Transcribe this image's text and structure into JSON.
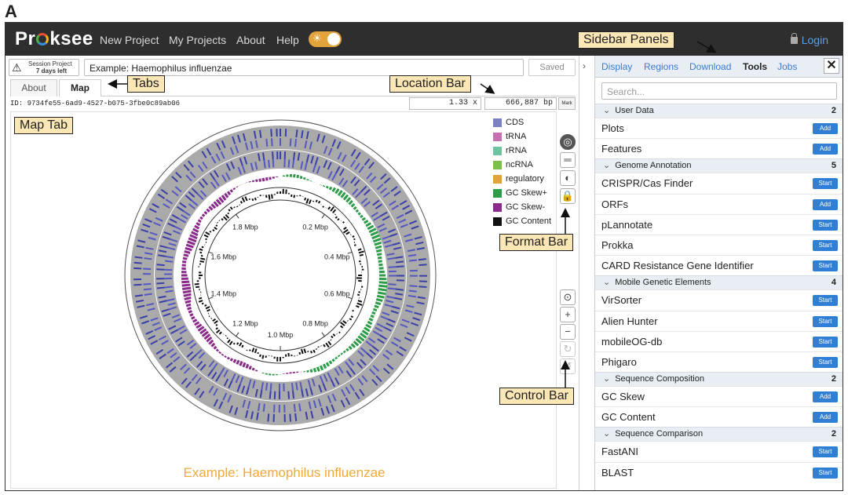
{
  "figure_letter": "A",
  "header": {
    "logo": "Proksee",
    "nav": [
      "New Project",
      "My Projects",
      "About",
      "Help"
    ],
    "login": "Login",
    "theme_toggle": "on"
  },
  "session": {
    "line1": "Session Project",
    "line2": "7 days left"
  },
  "project_title": "Example: Haemophilus influenzae",
  "saved_label": "Saved",
  "tabs": [
    {
      "label": "About"
    },
    {
      "label": "Map"
    }
  ],
  "active_tab": "Map",
  "map_id": "ID: 9734fe55-6ad9-4527-b075-3fbe0c89ab06",
  "zoom": "1.33 x",
  "location": "666,887 bp",
  "mark_label": "Mark",
  "legend": [
    {
      "label": "CDS",
      "color": "#7b7fc4"
    },
    {
      "label": "tRNA",
      "color": "#c66fb3"
    },
    {
      "label": "rRNA",
      "color": "#6fc4a0"
    },
    {
      "label": "ncRNA",
      "color": "#7ac04a"
    },
    {
      "label": "regulatory",
      "color": "#e3a33b"
    },
    {
      "label": "GC Skew+",
      "color": "#2e9c48"
    },
    {
      "label": "GC Skew-",
      "color": "#8a2a8a"
    },
    {
      "label": "GC Content",
      "color": "#111111"
    }
  ],
  "map_ticks": [
    "0.2 Mbp",
    "0.4 Mbp",
    "0.6 Mbp",
    "0.8 Mbp",
    "1.0 Mbp",
    "1.2 Mbp",
    "1.4 Mbp",
    "1.6 Mbp",
    "1.8 Mbp"
  ],
  "map_caption": "Example: Haemophilus influenzae",
  "sidebar": {
    "tabs": [
      "Display",
      "Regions",
      "Download",
      "Tools",
      "Jobs"
    ],
    "active_tab": "Tools",
    "search_placeholder": "Search...",
    "sections": [
      {
        "title": "User Data",
        "count": "2",
        "items": [
          {
            "label": "Plots",
            "button": "Add"
          },
          {
            "label": "Features",
            "button": "Add"
          }
        ]
      },
      {
        "title": "Genome Annotation",
        "count": "5",
        "items": [
          {
            "label": "CRISPR/Cas Finder",
            "button": "Start"
          },
          {
            "label": "ORFs",
            "button": "Add"
          },
          {
            "label": "pLannotate",
            "button": "Start"
          },
          {
            "label": "Prokka",
            "button": "Start"
          },
          {
            "label": "CARD Resistance Gene Identifier",
            "button": "Start"
          }
        ]
      },
      {
        "title": "Mobile Genetic Elements",
        "count": "4",
        "items": [
          {
            "label": "VirSorter",
            "button": "Start"
          },
          {
            "label": "Alien Hunter",
            "button": "Start"
          },
          {
            "label": "mobileOG-db",
            "button": "Start"
          },
          {
            "label": "Phigaro",
            "button": "Start"
          }
        ]
      },
      {
        "title": "Sequence Composition",
        "count": "2",
        "items": [
          {
            "label": "GC Skew",
            "button": "Add"
          },
          {
            "label": "GC Content",
            "button": "Add"
          }
        ]
      },
      {
        "title": "Sequence Comparison",
        "count": "2",
        "items": [
          {
            "label": "FastANI",
            "button": "Start"
          },
          {
            "label": "BLAST",
            "button": "Start"
          }
        ]
      }
    ]
  },
  "callouts": {
    "sidebar_panels": "Sidebar Panels",
    "tabs": "Tabs",
    "location_bar": "Location Bar",
    "map_tab": "Map Tab",
    "format_bar": "Format Bar",
    "control_bar": "Control Bar"
  }
}
